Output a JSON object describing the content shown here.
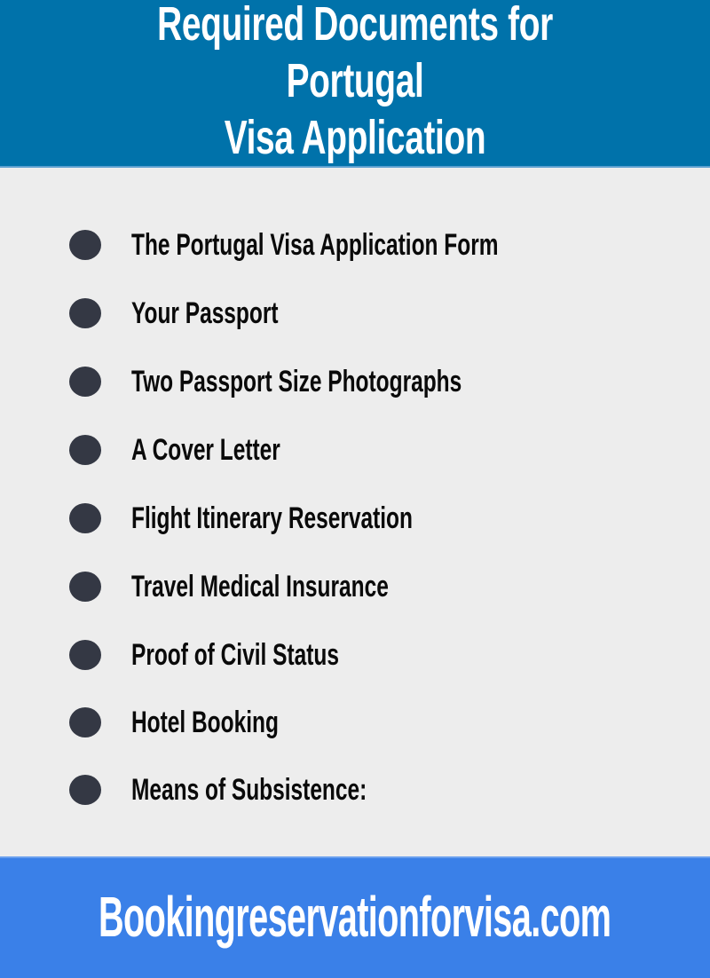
{
  "header": {
    "title_line1": "Required Documents for Portugal",
    "title_line2": "Visa Application"
  },
  "documents": [
    {
      "label": "The Portugal Visa Application Form",
      "icon": "bullet-dot"
    },
    {
      "label": "Your Passport",
      "icon": "bullet-dot"
    },
    {
      "label": "Two Passport Size Photographs",
      "icon": "bullet-dot"
    },
    {
      "label": "A Cover Letter",
      "icon": "bullet-dot"
    },
    {
      "label": "Flight Itinerary Reservation",
      "icon": "bullet-dot"
    },
    {
      "label": "Travel Medical Insurance",
      "icon": "bullet-dot"
    },
    {
      "label": "Proof of Civil Status",
      "icon": "bullet-dot"
    },
    {
      "label": "Hotel Booking",
      "icon": "bullet-dot"
    },
    {
      "label": "Means of Subsistence:",
      "icon": "bullet-dot"
    }
  ],
  "footer": {
    "website": "Bookingreservationforvisa.com"
  },
  "colors": {
    "header_bg": "#0072aa",
    "body_bg": "#ededed",
    "bullet": "#343844",
    "footer_bg": "#3a80e8",
    "text_light": "#ffffff",
    "text_dark": "#0a0a0a"
  }
}
